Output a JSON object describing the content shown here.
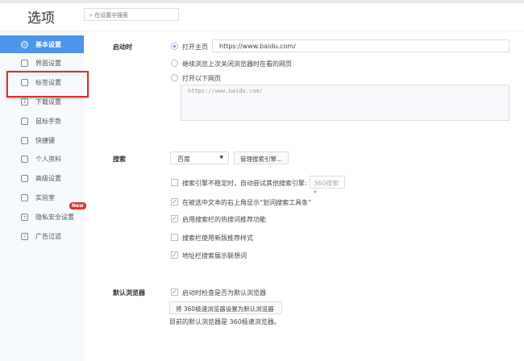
{
  "header": {
    "title": "选项",
    "search_placeholder": "在设置中搜索"
  },
  "sidebar": {
    "items": [
      {
        "label": "基本设置",
        "icon": "target-icon"
      },
      {
        "label": "界面设置",
        "icon": "window-icon"
      },
      {
        "label": "标签设置",
        "icon": "tab-icon"
      },
      {
        "label": "下载设置",
        "icon": "download-icon"
      },
      {
        "label": "鼠标手势",
        "icon": "mouse-icon"
      },
      {
        "label": "快捷键",
        "icon": "keyboard-icon"
      },
      {
        "label": "个人资料",
        "icon": "user-icon"
      },
      {
        "label": "高级设置",
        "icon": "wrench-icon"
      },
      {
        "label": "实验室",
        "icon": "flask-icon"
      },
      {
        "label": "隐私安全设置",
        "icon": "shield-icon"
      },
      {
        "label": "广告过滤",
        "icon": "block-icon"
      }
    ],
    "new_badge": "New",
    "active_color": "#4d94ea",
    "highlight_color": "#d9302c"
  },
  "startup": {
    "label": "启动时",
    "opt1": "打开主页",
    "homepage": "https://www.baidu.com/",
    "opt2": "继续浏览上次关闭浏览器时在看的网页",
    "opt3": "打开以下网页",
    "pages": "https://www.baidu.com/"
  },
  "search": {
    "label": "搜索",
    "engine": "百度",
    "manage": "管理搜索引擎...",
    "opts": [
      {
        "label": "搜索引擎不稳定时，自动尝试其他搜索引擎:",
        "checked": false
      },
      {
        "label": "在被选中文本的右上角显示“划词搜索工具条”",
        "checked": true
      },
      {
        "label": "启用搜索栏的热搜词推荐功能",
        "checked": true
      },
      {
        "label": "搜索栏使用新版推荐样式",
        "checked": false
      },
      {
        "label": "地址栏搜索展示联想词",
        "checked": true
      }
    ],
    "fallback": "360搜索"
  },
  "default_browser": {
    "label": "默认浏览器",
    "check": "启动时检查是否为默认浏览器",
    "button": "将 360极速浏览器设置为默认浏览器",
    "status": "目前的默认浏览器是 360极速浏览器。"
  }
}
